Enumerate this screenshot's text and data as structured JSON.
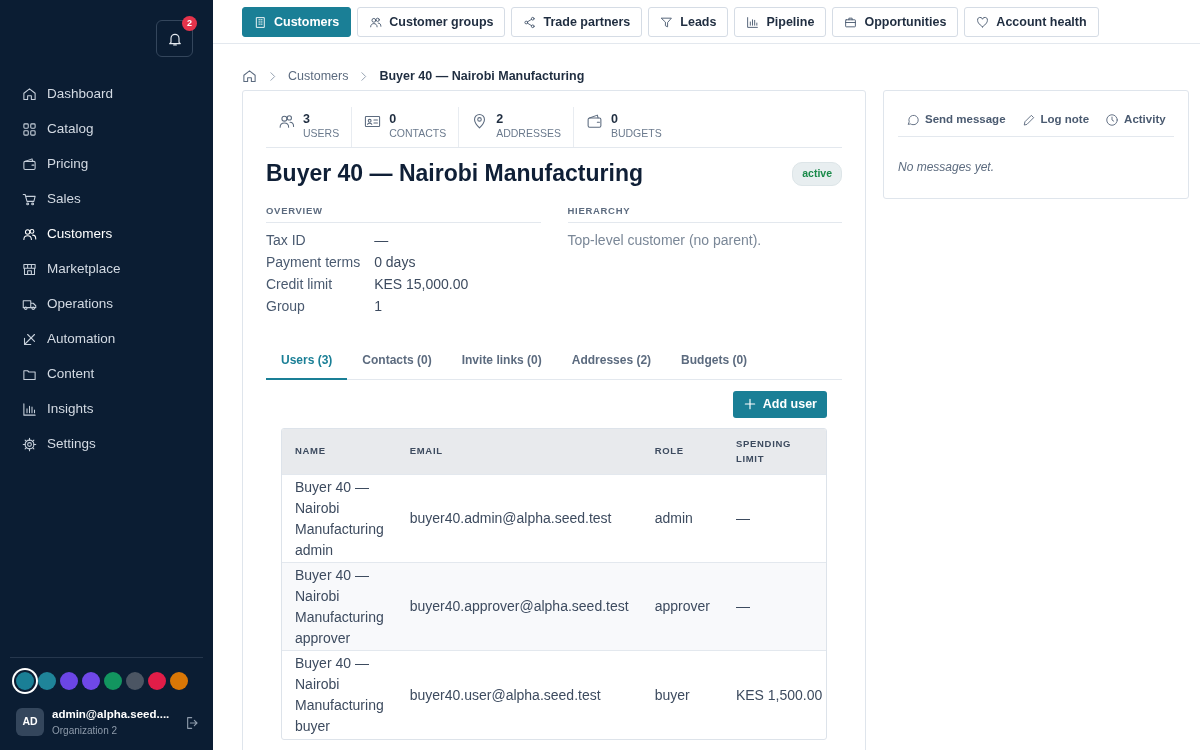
{
  "sidebar": {
    "notifications": {
      "count": "2"
    },
    "items": [
      {
        "label": "Dashboard",
        "selected": false
      },
      {
        "label": "Catalog",
        "selected": false
      },
      {
        "label": "Pricing",
        "selected": false
      },
      {
        "label": "Sales",
        "selected": false
      },
      {
        "label": "Customers",
        "selected": true
      },
      {
        "label": "Marketplace",
        "selected": false
      },
      {
        "label": "Operations",
        "selected": false
      },
      {
        "label": "Automation",
        "selected": false
      },
      {
        "label": "Content",
        "selected": false
      },
      {
        "label": "Insights",
        "selected": false
      },
      {
        "label": "Settings",
        "selected": false
      }
    ],
    "swatches": [
      {
        "color": "#1a7f96",
        "selected": true
      },
      {
        "color": "#1f8499",
        "selected": false
      },
      {
        "color": "#6b46e5",
        "selected": false
      },
      {
        "color": "#7048e8",
        "selected": false
      },
      {
        "color": "#12955f",
        "selected": false
      },
      {
        "color": "#4b5563",
        "selected": false
      },
      {
        "color": "#e11d48",
        "selected": false
      },
      {
        "color": "#d97706",
        "selected": false
      }
    ],
    "user": {
      "initials": "AD",
      "name": "admin@alpha.seed....",
      "org": "Organization 2"
    }
  },
  "top_tabs": [
    {
      "label": "Customers",
      "selected": true
    },
    {
      "label": "Customer groups",
      "selected": false
    },
    {
      "label": "Trade partners",
      "selected": false
    },
    {
      "label": "Leads",
      "selected": false
    },
    {
      "label": "Pipeline",
      "selected": false
    },
    {
      "label": "Opportunities",
      "selected": false
    },
    {
      "label": "Account health",
      "selected": false
    }
  ],
  "breadcrumb": [
    "Customers",
    "Buyer 40 — Nairobi Manufacturing"
  ],
  "customer": {
    "stats": [
      {
        "value": "3",
        "label": "USERS"
      },
      {
        "value": "0",
        "label": "CONTACTS"
      },
      {
        "value": "2",
        "label": "ADDRESSES"
      },
      {
        "value": "0",
        "label": "BUDGETS"
      }
    ],
    "title": "Buyer 40 — Nairobi Manufacturing",
    "status": "active",
    "overview": {
      "heading": "OVERVIEW",
      "fields": [
        {
          "label": "Tax ID",
          "value": "—"
        },
        {
          "label": "Payment terms",
          "value": "0 days"
        },
        {
          "label": "Credit limit",
          "value": "KES 15,000.00"
        },
        {
          "label": "Group",
          "value": "1"
        }
      ]
    },
    "hierarchy": {
      "heading": "HIERARCHY",
      "text": "Top-level customer (no parent)."
    },
    "tabs": [
      {
        "label": "Users (3)",
        "selected": true
      },
      {
        "label": "Contacts (0)",
        "selected": false
      },
      {
        "label": "Invite links (0)",
        "selected": false
      },
      {
        "label": "Addresses (2)",
        "selected": false
      },
      {
        "label": "Budgets (0)",
        "selected": false
      }
    ],
    "add_button": "Add user",
    "table": {
      "columns": [
        "NAME",
        "EMAIL",
        "ROLE",
        "SPENDING LIMIT"
      ],
      "rows": [
        [
          "Buyer 40 — Nairobi Manufacturing admin",
          "buyer40.admin@alpha.seed.test",
          "admin",
          "—"
        ],
        [
          "Buyer 40 — Nairobi Manufacturing approver",
          "buyer40.approver@alpha.seed.test",
          "approver",
          "—"
        ],
        [
          "Buyer 40 — Nairobi Manufacturing buyer",
          "buyer40.user@alpha.seed.test",
          "buyer",
          "KES 1,500.00"
        ]
      ]
    }
  },
  "chatter": {
    "actions": [
      "Send message",
      "Log note",
      "Activity"
    ],
    "empty": "No messages yet."
  }
}
